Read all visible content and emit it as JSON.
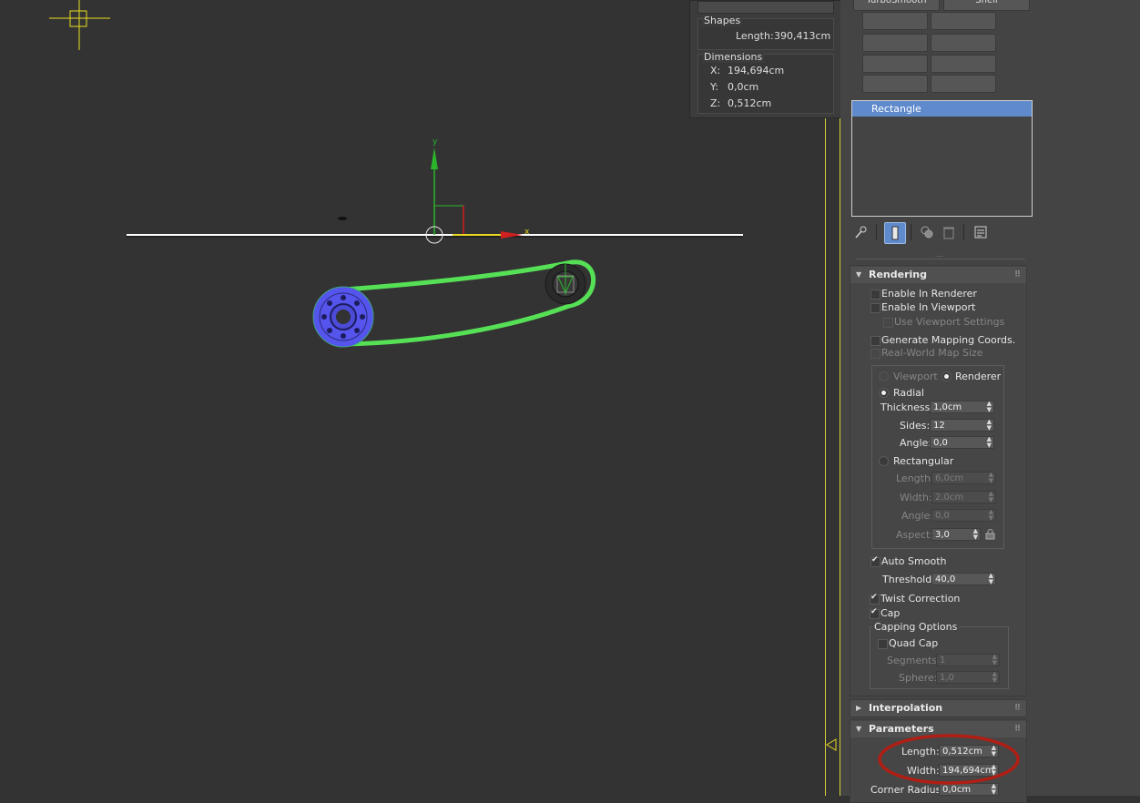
{
  "measure": {
    "shapes_label": "Shapes",
    "length_label": "Length:",
    "length_value": "390,413cm",
    "dimensions_label": "Dimensions",
    "x_label": "X:",
    "x_value": "194,694cm",
    "y_label": "Y:",
    "y_value": "0,0cm",
    "z_label": "Z:",
    "z_value": "0,512cm"
  },
  "gizmo": {
    "y_axis": "y",
    "x_axis": "x"
  },
  "modifier_buttons": [
    "TurboSmooth",
    "Shell",
    "",
    "",
    "",
    "",
    "",
    "",
    "",
    ""
  ],
  "stack": {
    "selected": "Rectangle"
  },
  "stack_tools": [
    "pin-stack-icon",
    "show-end-result-icon",
    "make-unique-icon",
    "remove-modifier-icon",
    "configure-modifier-sets-icon"
  ],
  "rendering": {
    "title": "Rendering",
    "enable_in_renderer": "Enable In Renderer",
    "enable_in_viewport": "Enable In Viewport",
    "use_viewport_settings": "Use Viewport Settings",
    "generate_mapping": "Generate Mapping Coords.",
    "real_world_map": "Real-World Map Size",
    "viewport_radio": "Viewport",
    "renderer_radio": "Renderer",
    "radial": "Radial",
    "thickness_label": "Thickness:",
    "thickness_value": "1,0cm",
    "sides_label": "Sides:",
    "sides_value": "12",
    "angle_label": "Angle:",
    "angle_value": "0,0",
    "rectangular": "Rectangular",
    "rect_length_label": "Length:",
    "rect_length_value": "6,0cm",
    "rect_width_label": "Width:",
    "rect_width_value": "2,0cm",
    "rect_angle_label": "Angle:",
    "rect_angle_value": "0,0",
    "aspect_label": "Aspect:",
    "aspect_value": "3,0",
    "auto_smooth": "Auto Smooth",
    "threshold_label": "Threshold:",
    "threshold_value": "40,0",
    "twist_correction": "Twist Correction",
    "cap": "Cap",
    "capping_options": "Capping Options",
    "quad_cap": "Quad Cap",
    "segments_label": "Segments:",
    "segments_value": "1",
    "sphere_label": "Sphere:",
    "sphere_value": "1,0"
  },
  "interpolation": {
    "title": "Interpolation"
  },
  "parameters": {
    "title": "Parameters",
    "length_label": "Length:",
    "length_value": "0,512cm",
    "width_label": "Width:",
    "width_value": "194,694cm",
    "corner_radius_label": "Corner Radius:",
    "corner_radius_value": "0,0cm"
  },
  "colors": {
    "viewport_bg": "#333333",
    "panel_bg": "#444444",
    "selection_blue": "#5f8acc",
    "chain_green": "#55e055",
    "gear_blue": "#5555ee",
    "annotation_red": "#b01e14",
    "viewport_border": "#d8d03a"
  }
}
